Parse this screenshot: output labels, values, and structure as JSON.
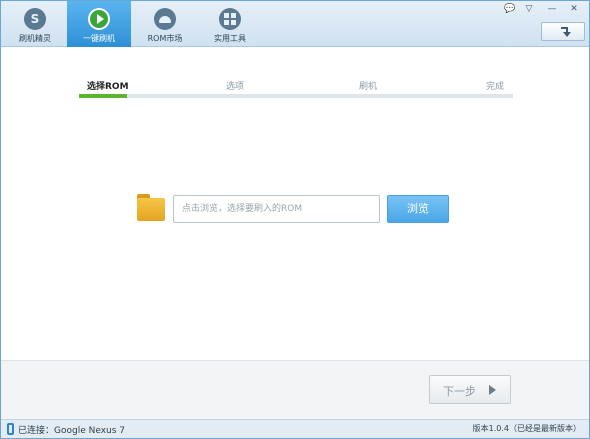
{
  "nav": {
    "tabs": [
      {
        "label": "刷机精灵",
        "icon": "s-logo-icon",
        "active": false
      },
      {
        "label": "一键刷机",
        "icon": "play-icon",
        "active": true
      },
      {
        "label": "ROM市场",
        "icon": "android-icon",
        "active": false
      },
      {
        "label": "实用工具",
        "icon": "grid-icon",
        "active": false
      }
    ]
  },
  "window": {
    "feedback_glyph": "💬",
    "menu_glyph": "▽",
    "minimize_glyph": "—",
    "close_glyph": "✕"
  },
  "steps": {
    "items": [
      "选择ROM",
      "选项",
      "刷机",
      "完成"
    ],
    "current_index": 0,
    "progress": 0.11
  },
  "browse": {
    "placeholder": "点击浏览，选择要刷入的ROM",
    "value": "",
    "button_label": "浏览"
  },
  "footer": {
    "next_label": "下一步",
    "connection_text": "已连接：Google Nexus 7",
    "version_text": "版本1.0.4（已经是最新版本）"
  },
  "colors": {
    "accent": "#3a9be0",
    "progress": "#5cb52e",
    "folder": "#f2b93b"
  }
}
